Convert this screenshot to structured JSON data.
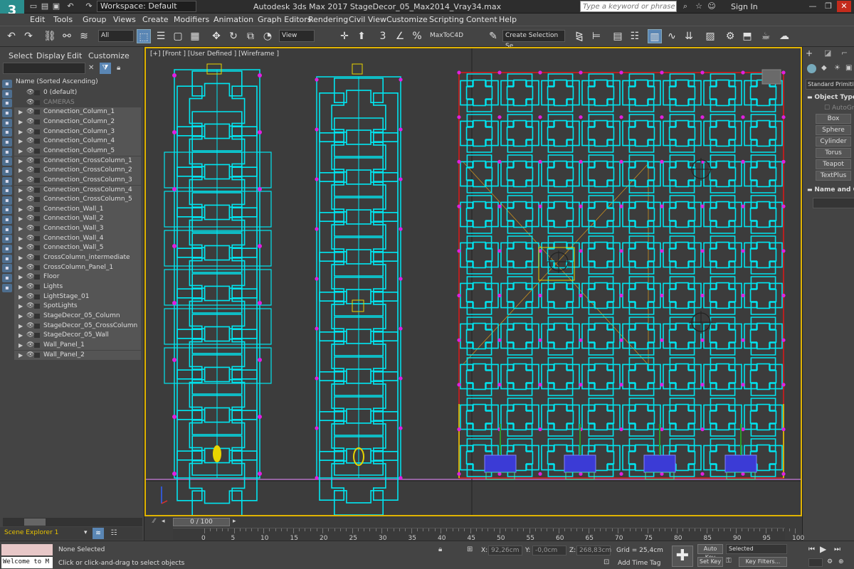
{
  "titlebar": {
    "workspace": "Workspace: Default",
    "title": "Autodesk 3ds Max 2017      StageDecor_05_Max2014_Vray34.max",
    "search_placeholder": "Type a keyword or phrase",
    "signin": "Sign In",
    "win_minimize": "—",
    "win_restore": "❐",
    "win_close": "✕"
  },
  "menu": {
    "items": [
      "Edit",
      "Tools",
      "Group",
      "Views",
      "Create",
      "Modifiers",
      "Animation",
      "Graph Editors",
      "Rendering",
      "Civil View",
      "Customize",
      "Scripting",
      "Content",
      "Help"
    ]
  },
  "toolbar": {
    "selection_filter": "All",
    "ref_coord": "View",
    "maxtoc4d": "MaxToC4D",
    "named_selection": "Create Selection Se"
  },
  "scene_explorer": {
    "menu": [
      "Select",
      "Display",
      "Edit",
      "Customize"
    ],
    "column_header": "Name (Sorted Ascending)",
    "items": [
      "0 (default)",
      "CAMERAS",
      "Connection_Column_1",
      "Connection_Column_2",
      "Connection_Column_3",
      "Connection_Column_4",
      "Connection_Column_5",
      "Connection_CrossColumn_1",
      "Connection_CrossColumn_2",
      "Connection_CrossColumn_3",
      "Connection_CrossColumn_4",
      "Connection_CrossColumn_5",
      "Connection_Wall_1",
      "Connection_Wall_2",
      "Connection_Wall_3",
      "Connection_Wall_4",
      "Connection_Wall_5",
      "CrossColumn_intermediate",
      "CrossColumn_Panel_1",
      "Floor",
      "Lights",
      "LightStage_01",
      "SpotLights",
      "StageDecor_05_Column",
      "StageDecor_05_CrossColumn",
      "StageDecor_05_Wall",
      "Wall_Panel_1",
      "Wall_Panel_2"
    ],
    "footer_label": "Scene Explorer 1"
  },
  "viewport": {
    "label": "[+] [Front ] [User Defined ] [Wireframe ]"
  },
  "command_panel": {
    "category": "Standard Primitives",
    "object_type_head": "Object Type",
    "autogrid": "AutoGrid",
    "buttons": [
      "Box",
      "Sphere",
      "Cylinder",
      "Torus",
      "Teapot",
      "TextPlus"
    ],
    "name_color_head": "Name and Color"
  },
  "timeline": {
    "frame": "0 / 100",
    "ticks": [
      "0",
      "5",
      "10",
      "15",
      "20",
      "25",
      "30",
      "35",
      "40",
      "45",
      "50",
      "55",
      "60",
      "65",
      "70",
      "75",
      "80",
      "85",
      "90",
      "95",
      "100"
    ]
  },
  "status": {
    "maxscript": "Welcome to M",
    "selection": "None Selected",
    "prompt": "Click or click-and-drag to select objects",
    "x_label": "X:",
    "x_value": "92,26cm",
    "y_label": "Y:",
    "y_value": "-0,0cm",
    "z_label": "Z:",
    "z_value": "268,83cm",
    "grid": "Grid = 25,4cm",
    "add_time_tag": "Add Time Tag",
    "auto_key": "Auto Key",
    "set_key": "Set Key",
    "key_mode": "Selected",
    "key_filters": "Key Filters..."
  },
  "colors": {
    "wire_cyan": "#00e5f0",
    "wire_magenta": "#e020e0",
    "frame_red": "#e01818",
    "viewport_border": "#e0b300",
    "wire_blue": "#3b3bd6",
    "wire_yellow": "#e8d400"
  }
}
